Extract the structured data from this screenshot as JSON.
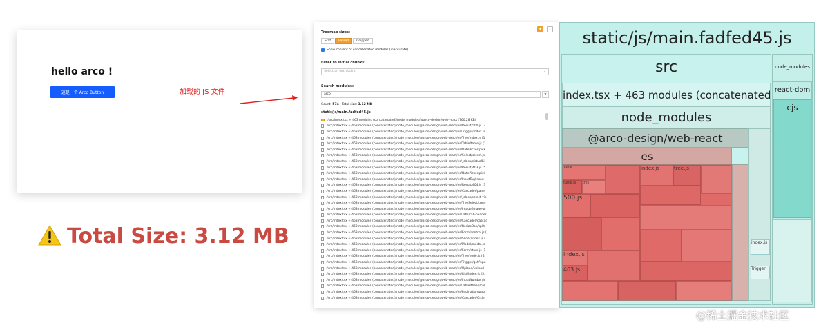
{
  "demo": {
    "title": "hello arco !",
    "button_label": "这是一个 Arco Button"
  },
  "annotation": {
    "js_note": "加载的 JS 文件",
    "total_size": "Total Size: 3.12 MB",
    "warning_icon": "warning-triangle-icon"
  },
  "sidebar": {
    "pin_icon": "pin-icon",
    "collapse_label": "‹",
    "treemap_sizes_label": "Treemap sizes:",
    "sizes": [
      "Stat",
      "Parsed",
      "Gzipped"
    ],
    "active_size": "Parsed",
    "show_concat_label": "Show content of concatenated modules (inaccurate)",
    "filter_label": "Filter to initial chunks:",
    "filter_placeholder": "Select an entrypoint",
    "search_label": "Search modules:",
    "search_value": "arco",
    "clear_label": "×",
    "count_label": "Count:",
    "count_value": "574",
    "total_size_label": "Total size:",
    "total_size_value": "3.12 MB",
    "bundle_name": "static/js/main.fadfed45.js",
    "tree_rows": [
      "./src/index.tsx + 463 modules (concatenated)/node_modules/@arco-design/web-react (760.28 KB)",
      "./src/index.tsx + 463 modules (concatenated)/node_modules/@arco-design/web-react/es/Result/500.js (2",
      "./src/index.tsx + 463 modules (concatenated)/node_modules/@arco-design/web-react/es/Trigger/index.js",
      "./src/index.tsx + 463 modules (concatenated)/node_modules/@arco-design/web-react/es/Tree/index.js (1",
      "./src/index.tsx + 463 modules (concatenated)/node_modules/@arco-design/web-react/es/Table/table.js (1",
      "./src/index.tsx + 463 modules (concatenated)/node_modules/@arco-design/web-react/es/DatePicker/pick",
      "./src/index.tsx + 463 modules (concatenated)/node_modules/@arco-design/web-react/es/Select/select.js",
      "./src/index.tsx + 463 modules (concatenated)/node_modules/@arco-design/web-react/es/_class/VirtualLi",
      "./src/index.tsx + 463 modules (concatenated)/node_modules/@arco-design/web-react/es/Result/403.js (5",
      "./src/index.tsx + 463 modules (concatenated)/node_modules/@arco-design/web-react/es/DatePicker/pick",
      "./src/index.tsx + 463 modules (concatenated)/node_modules/@arco-design/web-react/es/InputTag/input-",
      "./src/index.tsx + 463 modules (concatenated)/node_modules/@arco-design/web-react/es/Result/404.js (3",
      "./src/index.tsx + 463 modules (concatenated)/node_modules/@arco-design/web-react/es/Cascader/panel",
      "./src/index.tsx + 463 modules (concatenated)/node_modules/@arco-design/web-react/es/_class/select-vie",
      "./src/index.tsx + 463 modules (concatenated)/node_modules/@arco-design/web-react/es/TreeSelect/tree-",
      "./src/index.tsx + 463 modules (concatenated)/node_modules/@arco-design/web-react/es/Image/image-pr",
      "./src/index.tsx + 463 modules (concatenated)/node_modules/@arco-design/web-react/es/Tabs/tab-header",
      "./src/index.tsx + 463 modules (concatenated)/node_modules/@arco-design/web-react/es/Cascader/cascad",
      "./src/index.tsx + 463 modules (concatenated)/node_modules/@arco-design/web-react/es/ResizeBox/split-",
      "./src/index.tsx + 463 modules (concatenated)/node_modules/@arco-design/web-react/es/Form/control.js (",
      "./src/index.tsx + 463 modules (concatenated)/node_modules/@arco-design/web-react/es/Slider/index.js (",
      "./src/index.tsx + 463 modules (concatenated)/node_modules/@arco-design/web-react/es/Modal/modal.js",
      "./src/index.tsx + 463 modules (concatenated)/node_modules/@arco-design/web-react/es/Form/store.js (1",
      "./src/index.tsx + 463 modules (concatenated)/node_modules/@arco-design/web-react/es/Tree/node.js (6.",
      "./src/index.tsx + 463 modules (concatenated)/node_modules/@arco-design/web-react/es/Trigger/getPopu",
      "./src/index.tsx + 463 modules (concatenated)/node_modules/@arco-design/web-react/es/Upload/upload",
      "./src/index.tsx + 463 modules (concatenated)/node_modules/@arco-design/web-react/es/List/index.js (5.",
      "./src/index.tsx + 463 modules (concatenated)/node_modules/@arco-design/web-react/es/InputNumber/in",
      "./src/index.tsx + 463 modules (concatenated)/node_modules/@arco-design/web-react/es/Table/thead/col",
      "./src/index.tsx + 463 modules (concatenated)/node_modules/@arco-design/web-react/es/Pagination/pagi",
      "./src/index.tsx + 463 modules (concatenated)/node_modules/@arco-design/web-react/es/Cascader/Order"
    ]
  },
  "treemap": {
    "bundle": "static/js/main.fadfed45.js",
    "src": "src",
    "concat": "index.tsx + 463 modules (concatenated)",
    "node_modules": "node_modules",
    "arco": "@arco-design/web-react",
    "es": "es",
    "right_node_modules": "node_modules",
    "react_dom": "react-dom",
    "cjs": "cjs",
    "cells": [
      "Table",
      "table.js",
      "tr.js",
      "index.js",
      "tree.js",
      "500.js",
      "index.js",
      "403.js",
      "index.js",
      "Index.js",
      "Trigger"
    ],
    "colors": {
      "base": "#c4f0ec",
      "header": "#d6f4f1",
      "arco_header": "#b8c9c4",
      "es_header": "#d4a7a2",
      "red": "#e06a68",
      "right_green": "#82d9cc"
    }
  },
  "watermark": "@稀土掘金技术社区"
}
